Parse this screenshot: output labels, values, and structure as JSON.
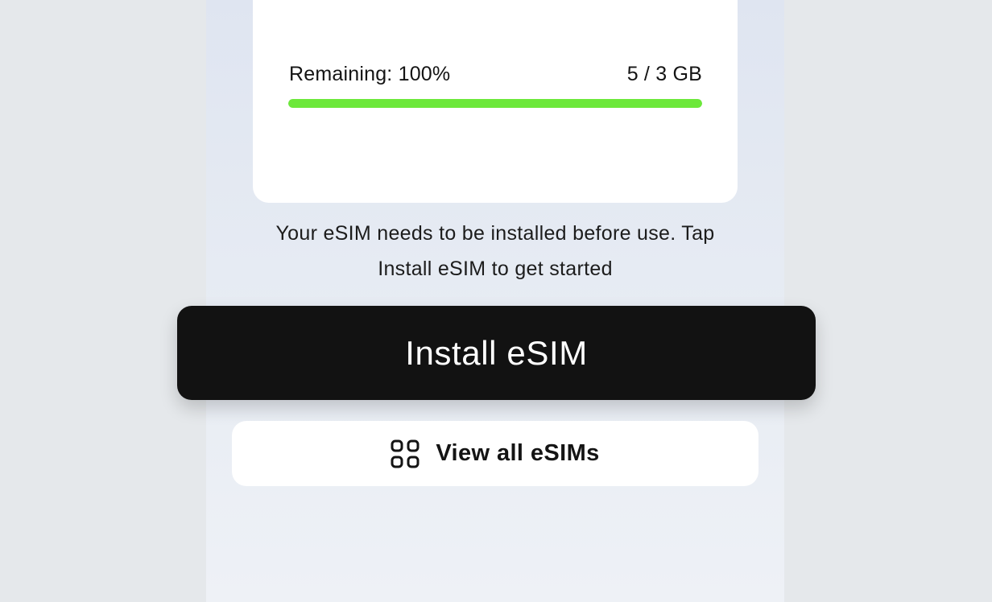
{
  "usage": {
    "remaining_label": "Remaining: 100%",
    "amount_label": "5 / 3 GB",
    "remaining_fraction": 1.0,
    "bar_color": "#6ce83a"
  },
  "hint": {
    "line1": "Your eSIM needs to be installed before use. Tap",
    "line2": "Install eSIM to get started"
  },
  "actions": {
    "install_label": "Install eSIM",
    "view_all_label": "View all eSIMs",
    "view_all_icon": "grid-icon"
  }
}
